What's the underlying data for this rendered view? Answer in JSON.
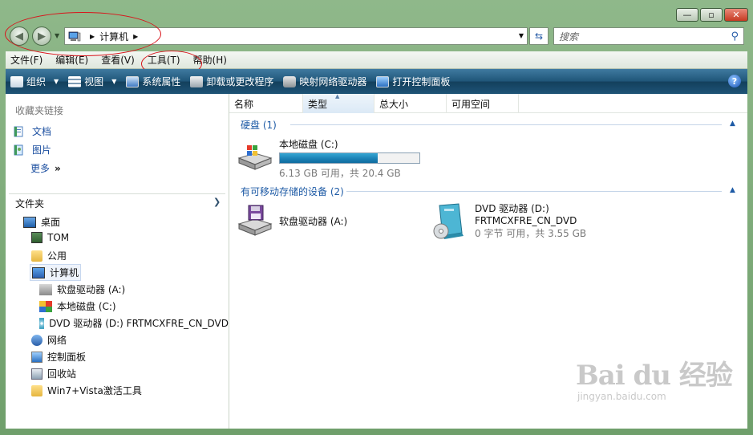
{
  "window": {
    "caption_buttons": [
      "—",
      "▫",
      "✕"
    ]
  },
  "address": {
    "crumb": "计算机",
    "search_placeholder": "搜索"
  },
  "menu": [
    "文件(F)",
    "编辑(E)",
    "查看(V)",
    "工具(T)",
    "帮助(H)"
  ],
  "commands": [
    {
      "label": "组织",
      "icon": "organize-icon"
    },
    {
      "label": "视图",
      "icon": "views-icon"
    },
    {
      "label": "系统属性",
      "icon": "system-properties-icon"
    },
    {
      "label": "卸载或更改程序",
      "icon": "uninstall-icon"
    },
    {
      "label": "映射网络驱动器",
      "icon": "map-network-drive-icon"
    },
    {
      "label": "打开控制面板",
      "icon": "control-panel-icon"
    }
  ],
  "favorites": {
    "title": "收藏夹链接",
    "items": [
      "文档",
      "图片",
      "更多"
    ],
    "more_glyph": "»"
  },
  "folders": {
    "title": "文件夹",
    "tree": [
      "桌面",
      "TOM",
      "公用",
      "计算机",
      "软盘驱动器 (A:)",
      "本地磁盘 (C:)",
      "DVD 驱动器 (D:) FRTMCXFRE_CN_DVD",
      "网络",
      "控制面板",
      "回收站",
      "Win7+Vista激活工具"
    ]
  },
  "columns": [
    "名称",
    "类型",
    "总大小",
    "可用空间"
  ],
  "groups": [
    {
      "label": "硬盘 (1)"
    },
    {
      "label": "有可移动存储的设备 (2)"
    }
  ],
  "drives": {
    "c": {
      "name": "本地磁盘 (C:)",
      "free_text": "6.13 GB 可用，共 20.4 GB",
      "used_fraction": 0.7
    },
    "a": {
      "name": "软盘驱动器 (A:)"
    },
    "d": {
      "name": "DVD 驱动器 (D:)",
      "label": "FRTMCXFRE_CN_DVD",
      "free_text": "0 字节 可用，共 3.55 GB"
    }
  },
  "watermark": {
    "brand": "Bai du 经验",
    "url": "jingyan.baidu.com"
  },
  "colors": {
    "command_bar": "#1f5578",
    "accent_blue": "#1d5aa5",
    "highlight_red": "#d9141b",
    "frame_green": "#6f9f6b"
  }
}
